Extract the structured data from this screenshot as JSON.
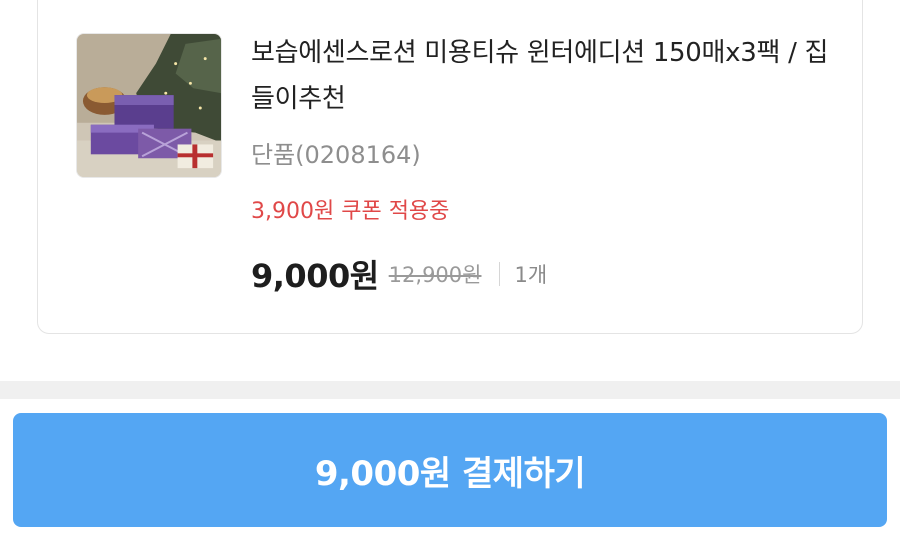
{
  "product": {
    "title": "보습에센스로션 미용티슈 윈터에디션 150매x3팩 / 집들이추천",
    "option": "단품(0208164)",
    "coupon_text": "3,900원 쿠폰 적용중",
    "price": "9,000원",
    "original_price": "12,900원",
    "quantity": "1개",
    "image_icon": "product-photo-tissue-boxes"
  },
  "checkout": {
    "pay_label": "9,000원 결제하기"
  },
  "colors": {
    "accent": "#54a6f3",
    "coupon": "#e04848",
    "divider": "#f0f0f0"
  }
}
